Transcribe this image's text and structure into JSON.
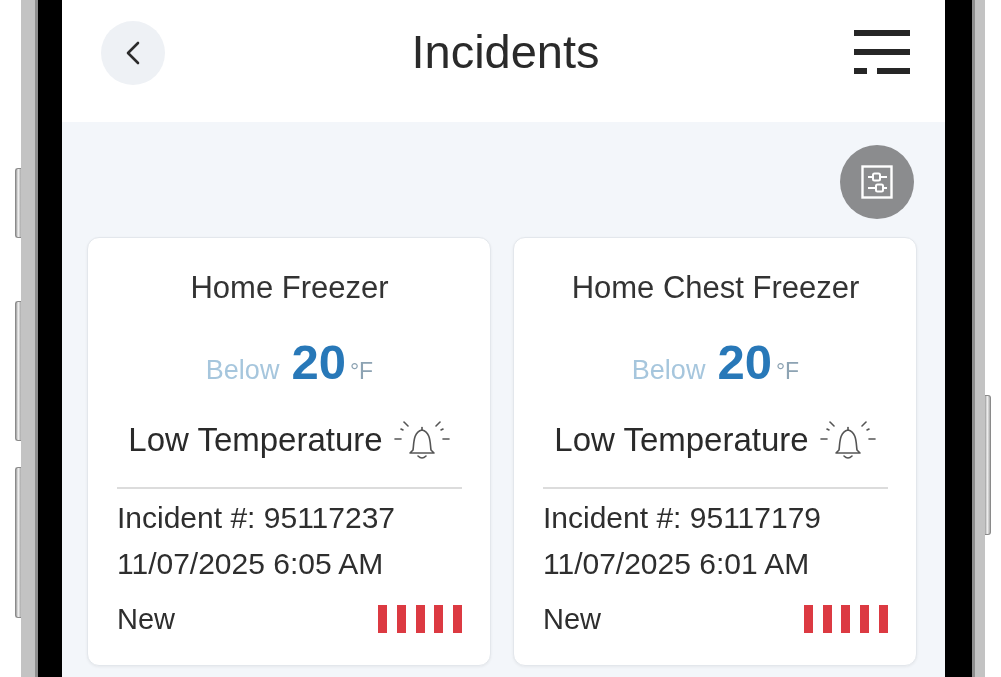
{
  "header": {
    "title": "Incidents"
  },
  "incidents": [
    {
      "device": "Home Freezer",
      "qualifier": "Below",
      "threshold": "20",
      "unit": "°F",
      "alert": "Low Temperature",
      "incident_number": "Incident #: 95117237",
      "timestamp": "11/07/2025 6:05 AM",
      "status": "New",
      "severity": {
        "level": 1
      }
    },
    {
      "device": "Home Chest Freezer",
      "qualifier": "Below",
      "threshold": "20",
      "unit": "°F",
      "alert": "Low Temperature",
      "incident_number": "Incident #: 95117179",
      "timestamp": "11/07/2025 6:01 AM",
      "status": "New",
      "severity": {
        "level": 1
      }
    }
  ]
}
